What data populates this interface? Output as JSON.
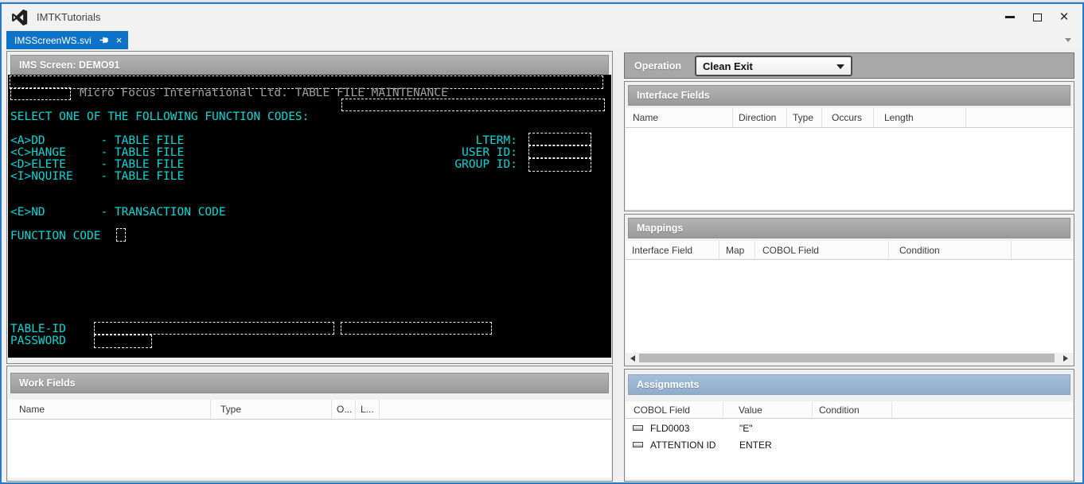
{
  "window": {
    "title": "IMTKTutorials",
    "controls": {
      "minimize": "minimize",
      "maximize": "maximize",
      "close": "×"
    }
  },
  "tab": {
    "label": "IMSScreenWS.svi",
    "close_glyph": "×"
  },
  "ims_screen": {
    "title": "IMS Screen: DEMO91",
    "banner": "Micro Focus International Ltd. TABLE FILE MAINTENANCE",
    "select_line": "SELECT ONE OF THE FOLLOWING FUNCTION CODES:",
    "code_lines": [
      "<A>DD        - TABLE FILE",
      "<C>HANGE     - TABLE FILE",
      "<D>ELETE     - TABLE FILE",
      "<I>NQUIRE    - TABLE FILE"
    ],
    "end_line": "<E>ND        - TRANSACTION CODE",
    "function_code_label": "FUNCTION CODE",
    "lterm_label": "LTERM:",
    "user_id_label": "USER ID:",
    "group_id_label": "GROUP ID:",
    "table_id_label": "TABLE-ID",
    "password_label": "PASSWORD"
  },
  "operation": {
    "label": "Operation",
    "selected": "Clean Exit"
  },
  "interface_fields": {
    "title": "Interface Fields",
    "columns": [
      "Name",
      "Direction",
      "Type",
      "Occurs",
      "Length"
    ],
    "rows": []
  },
  "mappings": {
    "title": "Mappings",
    "columns": [
      "Interface Field",
      "Map",
      "COBOL Field",
      "Condition"
    ],
    "rows": []
  },
  "work_fields": {
    "title": "Work Fields",
    "columns": [
      "Name",
      "Type",
      "O...",
      "L..."
    ],
    "rows": []
  },
  "assignments": {
    "title": "Assignments",
    "columns": [
      "COBOL Field",
      "Value",
      "Condition"
    ],
    "rows": [
      {
        "cobol_field": "FLD0003",
        "value": "\"E\"",
        "condition": ""
      },
      {
        "cobol_field": "ATTENTION ID",
        "value": "ENTER",
        "condition": ""
      }
    ]
  },
  "colors": {
    "accent_tab_blue": "#0e72c6",
    "window_border_blue": "#2779cc",
    "terminal_foreground_cyan": "#00d9d9",
    "terminal_dim_gray": "#9e9e9e",
    "panel_header_gray": "#a6a6a6",
    "assignments_header_blue": "#9bb5d0"
  }
}
